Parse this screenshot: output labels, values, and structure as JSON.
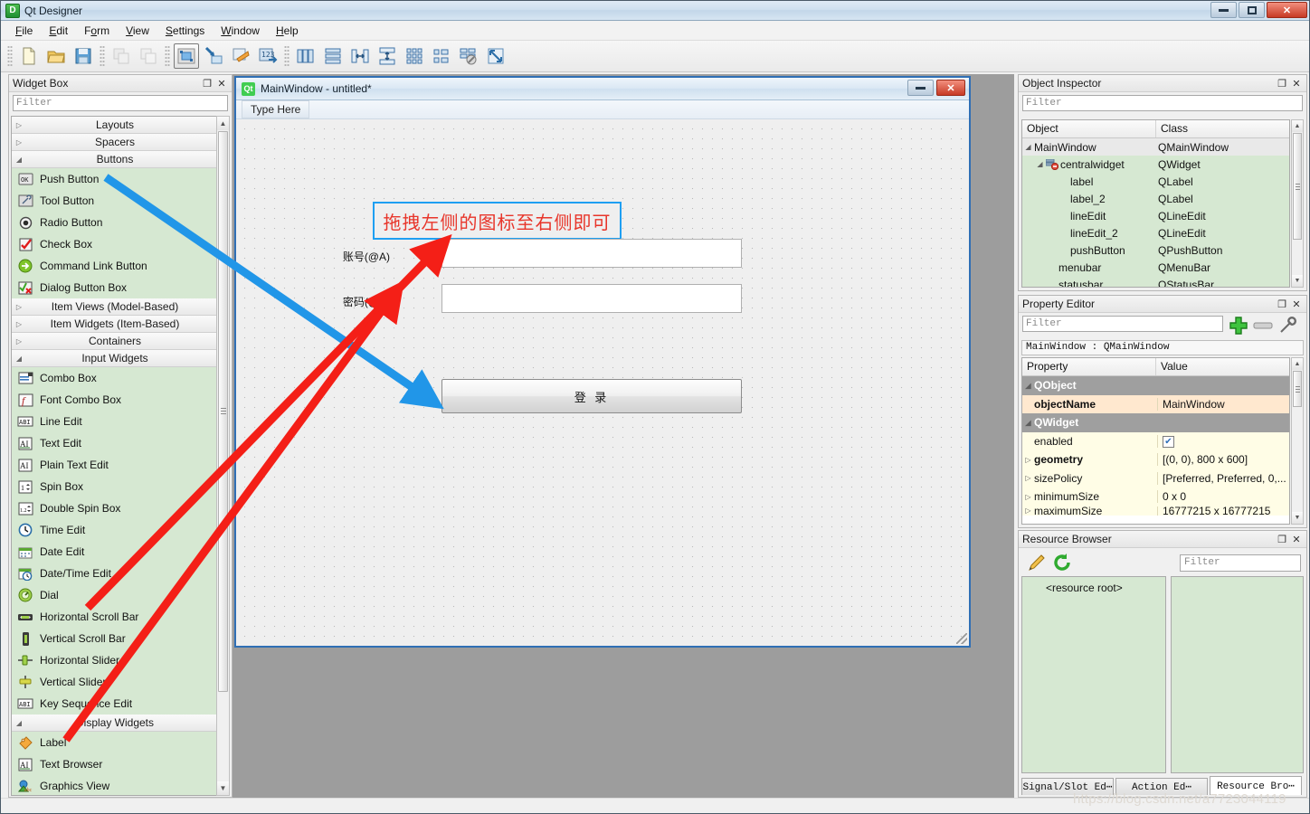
{
  "app": {
    "title": "Qt Designer",
    "icon": "qt-designer-icon",
    "window_buttons": {
      "minimize": "minimize-icon",
      "restore": "restore-icon",
      "close": "close-icon"
    }
  },
  "menubar": {
    "items": [
      {
        "label": "File",
        "accel": "F"
      },
      {
        "label": "Edit",
        "accel": "E"
      },
      {
        "label": "Form",
        "accel": "o"
      },
      {
        "label": "View",
        "accel": "V"
      },
      {
        "label": "Settings",
        "accel": "S"
      },
      {
        "label": "Window",
        "accel": "W"
      },
      {
        "label": "Help",
        "accel": "H"
      }
    ]
  },
  "toolbar": {
    "groups": [
      {
        "buttons": [
          {
            "name": "new-form-button",
            "icon": "new-document-icon",
            "enabled": true,
            "active": false
          },
          {
            "name": "open-form-button",
            "icon": "open-folder-icon",
            "enabled": true,
            "active": false
          },
          {
            "name": "save-form-button",
            "icon": "save-floppy-icon",
            "enabled": true,
            "active": false
          }
        ]
      },
      {
        "buttons": [
          {
            "name": "undo-button",
            "icon": "undo-icon",
            "enabled": false,
            "active": false
          },
          {
            "name": "redo-button",
            "icon": "redo-icon",
            "enabled": false,
            "active": false
          }
        ]
      },
      {
        "buttons": [
          {
            "name": "edit-widgets-button",
            "icon": "edit-widgets-icon",
            "enabled": true,
            "active": true
          },
          {
            "name": "edit-signals-slots-button",
            "icon": "signals-slots-icon",
            "enabled": true,
            "active": false
          },
          {
            "name": "edit-buddies-button",
            "icon": "buddies-icon",
            "enabled": true,
            "active": false
          },
          {
            "name": "edit-tab-order-button",
            "icon": "tab-order-icon",
            "enabled": true,
            "active": false
          }
        ]
      },
      {
        "buttons": [
          {
            "name": "layout-horizontal-button",
            "icon": "layout-horizontal-icon",
            "enabled": true,
            "active": false
          },
          {
            "name": "layout-vertical-button",
            "icon": "layout-vertical-icon",
            "enabled": true,
            "active": false
          },
          {
            "name": "layout-splitter-h-button",
            "icon": "splitter-horizontal-icon",
            "enabled": true,
            "active": false
          },
          {
            "name": "layout-splitter-v-button",
            "icon": "splitter-vertical-icon",
            "enabled": true,
            "active": false
          },
          {
            "name": "layout-grid-button",
            "icon": "layout-grid-icon",
            "enabled": true,
            "active": false
          },
          {
            "name": "layout-form-button",
            "icon": "layout-form-icon",
            "enabled": true,
            "active": false
          },
          {
            "name": "break-layout-button",
            "icon": "break-layout-icon",
            "enabled": true,
            "active": false
          },
          {
            "name": "adjust-size-button",
            "icon": "adjust-size-icon",
            "enabled": true,
            "active": false
          }
        ]
      }
    ]
  },
  "widget_box": {
    "title": "Widget Box",
    "filter_placeholder": "Filter",
    "categories": [
      {
        "label": "Layouts",
        "expanded": false,
        "items": []
      },
      {
        "label": "Spacers",
        "expanded": false,
        "items": []
      },
      {
        "label": "Buttons",
        "expanded": true,
        "items": [
          {
            "label": "Push Button",
            "icon": "push-button-icon"
          },
          {
            "label": "Tool Button",
            "icon": "tool-button-icon"
          },
          {
            "label": "Radio Button",
            "icon": "radio-button-icon"
          },
          {
            "label": "Check Box",
            "icon": "check-box-icon"
          },
          {
            "label": "Command Link Button",
            "icon": "command-link-icon"
          },
          {
            "label": "Dialog Button Box",
            "icon": "dialog-button-box-icon"
          }
        ]
      },
      {
        "label": "Item Views (Model-Based)",
        "expanded": false,
        "items": []
      },
      {
        "label": "Item Widgets (Item-Based)",
        "expanded": false,
        "items": []
      },
      {
        "label": "Containers",
        "expanded": false,
        "items": []
      },
      {
        "label": "Input Widgets",
        "expanded": true,
        "items": [
          {
            "label": "Combo Box",
            "icon": "combo-box-icon"
          },
          {
            "label": "Font Combo Box",
            "icon": "font-combo-box-icon"
          },
          {
            "label": "Line Edit",
            "icon": "line-edit-icon"
          },
          {
            "label": "Text Edit",
            "icon": "text-edit-icon"
          },
          {
            "label": "Plain Text Edit",
            "icon": "plain-text-edit-icon"
          },
          {
            "label": "Spin Box",
            "icon": "spin-box-icon"
          },
          {
            "label": "Double Spin Box",
            "icon": "double-spin-box-icon"
          },
          {
            "label": "Time Edit",
            "icon": "time-edit-icon"
          },
          {
            "label": "Date Edit",
            "icon": "date-edit-icon"
          },
          {
            "label": "Date/Time Edit",
            "icon": "date-time-edit-icon"
          },
          {
            "label": "Dial",
            "icon": "dial-icon"
          },
          {
            "label": "Horizontal Scroll Bar",
            "icon": "horizontal-scroll-bar-icon"
          },
          {
            "label": "Vertical Scroll Bar",
            "icon": "vertical-scroll-bar-icon"
          },
          {
            "label": "Horizontal Slider",
            "icon": "horizontal-slider-icon"
          },
          {
            "label": "Vertical Slider",
            "icon": "vertical-slider-icon"
          },
          {
            "label": "Key Sequence Edit",
            "icon": "key-sequence-edit-icon"
          }
        ]
      },
      {
        "label": "Display Widgets",
        "expanded": true,
        "items": [
          {
            "label": "Label",
            "icon": "label-icon"
          },
          {
            "label": "Text Browser",
            "icon": "text-browser-icon"
          },
          {
            "label": "Graphics View",
            "icon": "graphics-view-icon"
          }
        ]
      }
    ]
  },
  "form": {
    "title": "MainWindow - untitled*",
    "icon": "qt-logo-icon",
    "menubar_placeholder": "Type Here",
    "annotation": "拖拽左侧的图标至右侧即可",
    "annotation_color": "#e8352a",
    "annotation_border_color": "#1e9ff2",
    "fields": [
      {
        "label": "账号(@A)",
        "value": "",
        "name": "account-field"
      },
      {
        "label": "密码(@P)",
        "value": "",
        "name": "password-field"
      }
    ],
    "submit_label": "登 录",
    "window_buttons": {
      "minimize": "minimize-icon",
      "close": "close-icon"
    }
  },
  "annotations": {
    "red_arrow_color": "#f41f17",
    "blue_arrow_color": "#2196e8",
    "arrows": [
      {
        "from": "push-button-list-item",
        "to": "login-button",
        "color": "#2196e8"
      },
      {
        "from": "line-edit-list-item",
        "to": "account-input",
        "color": "#f41f17"
      },
      {
        "from": "label-list-item",
        "to": "password-input",
        "color": "#f41f17"
      }
    ]
  },
  "object_inspector": {
    "title": "Object Inspector",
    "filter_placeholder": "Filter",
    "columns": [
      "Object",
      "Class"
    ],
    "rows": [
      {
        "object": "MainWindow",
        "class": "QMainWindow",
        "depth": 0,
        "expander": "expanded",
        "icon": "",
        "selected": true
      },
      {
        "object": "centralwidget",
        "class": "QWidget",
        "depth": 1,
        "expander": "expanded",
        "icon": "no-layout-icon",
        "selected": false
      },
      {
        "object": "label",
        "class": "QLabel",
        "depth": 2,
        "expander": "",
        "icon": "",
        "selected": false
      },
      {
        "object": "label_2",
        "class": "QLabel",
        "depth": 2,
        "expander": "",
        "icon": "",
        "selected": false
      },
      {
        "object": "lineEdit",
        "class": "QLineEdit",
        "depth": 2,
        "expander": "",
        "icon": "",
        "selected": false
      },
      {
        "object": "lineEdit_2",
        "class": "QLineEdit",
        "depth": 2,
        "expander": "",
        "icon": "",
        "selected": false
      },
      {
        "object": "pushButton",
        "class": "QPushButton",
        "depth": 2,
        "expander": "",
        "icon": "",
        "selected": false
      },
      {
        "object": "menubar",
        "class": "QMenuBar",
        "depth": 1,
        "expander": "",
        "icon": "",
        "selected": false
      },
      {
        "object": "statusbar",
        "class": "QStatusBar",
        "depth": 1,
        "expander": "",
        "icon": "",
        "selected": false
      }
    ]
  },
  "property_editor": {
    "title": "Property Editor",
    "filter_placeholder": "Filter",
    "toolbar_icons": [
      "add-property-icon",
      "remove-property-icon",
      "configure-icon"
    ],
    "object_line": "MainWindow : QMainWindow",
    "columns": [
      "Property",
      "Value"
    ],
    "rows": [
      {
        "kind": "group",
        "property": "QObject",
        "value": ""
      },
      {
        "kind": "obj",
        "property": "objectName",
        "value": "MainWindow",
        "bold": true
      },
      {
        "kind": "group",
        "property": "QWidget",
        "value": ""
      },
      {
        "kind": "val",
        "property": "enabled",
        "value": "checked",
        "widget": "checkbox"
      },
      {
        "kind": "val",
        "property": "geometry",
        "value": "[(0, 0), 800 x 600]",
        "bold": true,
        "expander": true
      },
      {
        "kind": "val",
        "property": "sizePolicy",
        "value": "[Preferred, Preferred, 0,...",
        "expander": true
      },
      {
        "kind": "val",
        "property": "minimumSize",
        "value": "0 x 0",
        "expander": true
      },
      {
        "kind": "val",
        "property": "maximumSize",
        "value": "16777215 x 16777215",
        "expander": true
      }
    ]
  },
  "resource_browser": {
    "title": "Resource Browser",
    "filter_placeholder": "Filter",
    "toolbar_icons": [
      "edit-resources-icon",
      "reload-icon"
    ],
    "tree_root": "<resource root>",
    "tabs": [
      {
        "label": "Signal/Slot Ed⋯",
        "active": false
      },
      {
        "label": "Action Ed⋯",
        "active": false
      },
      {
        "label": "Resource Bro⋯",
        "active": true
      }
    ]
  },
  "watermark": "https://blog.csdn.net/a7723044119"
}
